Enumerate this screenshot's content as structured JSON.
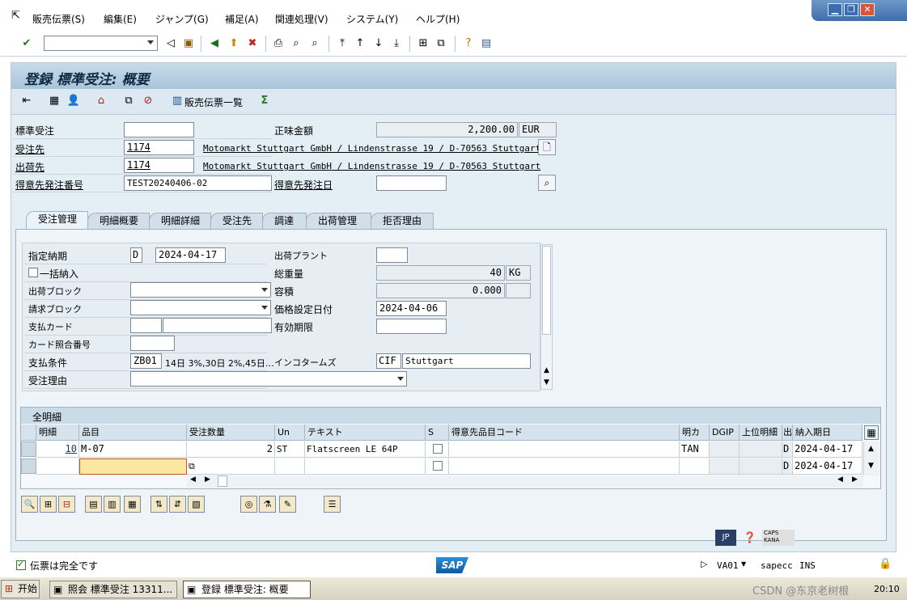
{
  "menu": {
    "items": [
      "販売伝票(S)",
      "編集(E)",
      "ジャンプ(G)",
      "補足(A)",
      "関連処理(V)",
      "システム(Y)",
      "ヘルプ(H)"
    ]
  },
  "title": "登録 標準受注: 概要",
  "apptoolbar": {
    "doc_list_label": "販売伝票一覧"
  },
  "header": {
    "order_label": "標準受注",
    "order_value": "",
    "net_amount_label": "正味金額",
    "net_amount_value": "2,200.00",
    "currency": "EUR",
    "soldto_label": "受注先",
    "soldto_value": "1174",
    "soldto_address": "Motomarkt Stuttgart GmbH / Lindenstrasse 19 / D-70563 Stuttgart",
    "shipto_label": "出荷先",
    "shipto_value": "1174",
    "shipto_address": "Motomarkt Stuttgart GmbH / Lindenstrasse 19 / D-70563 Stuttgart",
    "po_label": "得意先発注番号",
    "po_value": "TEST20240406-02",
    "po_date_label": "得意先発注日",
    "po_date_value": ""
  },
  "tabs": [
    {
      "label": "受注管理",
      "active": true
    },
    {
      "label": "明細概要",
      "active": false
    },
    {
      "label": "明細詳細",
      "active": false
    },
    {
      "label": "受注先",
      "active": false
    },
    {
      "label": "調達",
      "active": false
    },
    {
      "label": "出荷管理",
      "active": false
    },
    {
      "label": "拒否理由",
      "active": false
    }
  ],
  "sales": {
    "req_deliv_label": "指定納期",
    "req_deliv_type": "D",
    "req_deliv_date": "2024-04-17",
    "complete_deliv_label": "一括納入",
    "delivery_block_label": "出荷ブロック",
    "billing_block_label": "請求ブロック",
    "payment_card_label": "支払カード",
    "card_verif_label": "カード照合番号",
    "payment_terms_label": "支払条件",
    "payment_terms_code": "ZB01",
    "payment_terms_text": "14日 3%,30日 2%,45日…",
    "order_reason_label": "受注理由",
    "plant_label": "出荷プラント",
    "gross_weight_label": "総重量",
    "gross_weight_value": "40",
    "weight_unit": "KG",
    "volume_label": "容積",
    "volume_value": "0.000",
    "pricing_date_label": "価格設定日付",
    "pricing_date_value": "2024-04-06",
    "valid_until_label": "有効期限",
    "incoterms_label": "インコタームズ",
    "incoterms_code": "CIF",
    "incoterms_place": "Stuttgart"
  },
  "items_table": {
    "title": "全明細",
    "columns": [
      "明細",
      "品目",
      "受注数量",
      "Un",
      "テキスト",
      "S",
      "得意先品目コード",
      "明カ",
      "DGIP",
      "上位明細",
      "出",
      "納入期日"
    ],
    "rows": [
      {
        "item": "10",
        "material": "M-07",
        "qty": "2",
        "unit": "ST",
        "text": "Flatscreen LE 64P",
        "cat": "TAN",
        "d": "D",
        "date": "2024-04-17"
      },
      {
        "item": "",
        "material": "",
        "qty": "",
        "unit": "",
        "text": "",
        "cat": "",
        "d": "D",
        "date": "2024-04-17"
      }
    ]
  },
  "status": {
    "message": "伝票は完全です",
    "transaction": "VA01",
    "server": "sapecc",
    "mode": "INS",
    "lang": "JP",
    "caps": "CAPS",
    "kana": "KANA"
  },
  "taskbar": {
    "start": "开始",
    "tasks": [
      "照会 標準受注 13311...",
      "登録 標準受注: 概要"
    ],
    "watermark": "CSDN @东京老树根",
    "time": "20:10"
  },
  "colors": {
    "frame_bg": "#e4eef5",
    "title_bg": "#b0cadc",
    "input_highlight": "#fbe6a2"
  }
}
